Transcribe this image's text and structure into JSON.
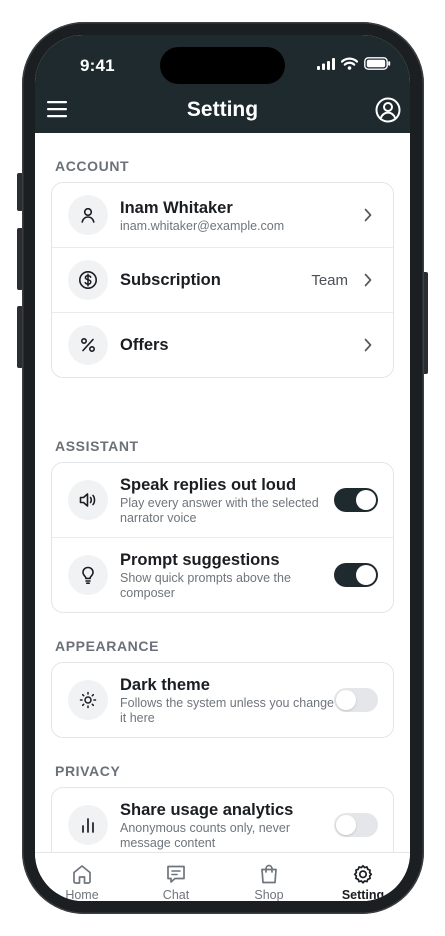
{
  "status_bar": {
    "time": "9:41"
  },
  "header": {
    "title": "Setting"
  },
  "sections": {
    "account": {
      "title": "ACCOUNT",
      "profile": {
        "name": "Inam Whitaker",
        "email": "inam.whitaker@example.com"
      },
      "subscription": {
        "label": "Subscription",
        "value": "Team"
      },
      "offers": {
        "label": "Offers"
      }
    },
    "assistant": {
      "title": "ASSISTANT",
      "speak": {
        "label": "Speak replies out loud",
        "description": "Play every answer with the selected narrator voice",
        "enabled": true
      },
      "prompts": {
        "label": "Prompt suggestions",
        "description": "Show quick prompts above the composer",
        "enabled": true
      }
    },
    "appearance": {
      "title": "APPEARANCE",
      "dark_theme": {
        "label": "Dark theme",
        "description": "Follows the system unless you change it here",
        "enabled": false
      }
    },
    "privacy": {
      "title": "PRIVACY",
      "analytics": {
        "label": "Share usage analytics",
        "description": "Anonymous counts only, never message content",
        "enabled": false
      }
    }
  },
  "tabbar": {
    "items": [
      {
        "label": "Home",
        "icon": "home-icon",
        "active": false
      },
      {
        "label": "Chat",
        "icon": "chat-icon",
        "active": false
      },
      {
        "label": "Shop",
        "icon": "shopping-bag-icon",
        "active": false
      },
      {
        "label": "Setting",
        "icon": "gear-icon",
        "active": true
      }
    ]
  },
  "colors": {
    "header_bg": "#1e2a2e",
    "toggle_on": "#1f2a2f",
    "toggle_off": "#e4e6e9",
    "section_title": "#6b7178"
  }
}
